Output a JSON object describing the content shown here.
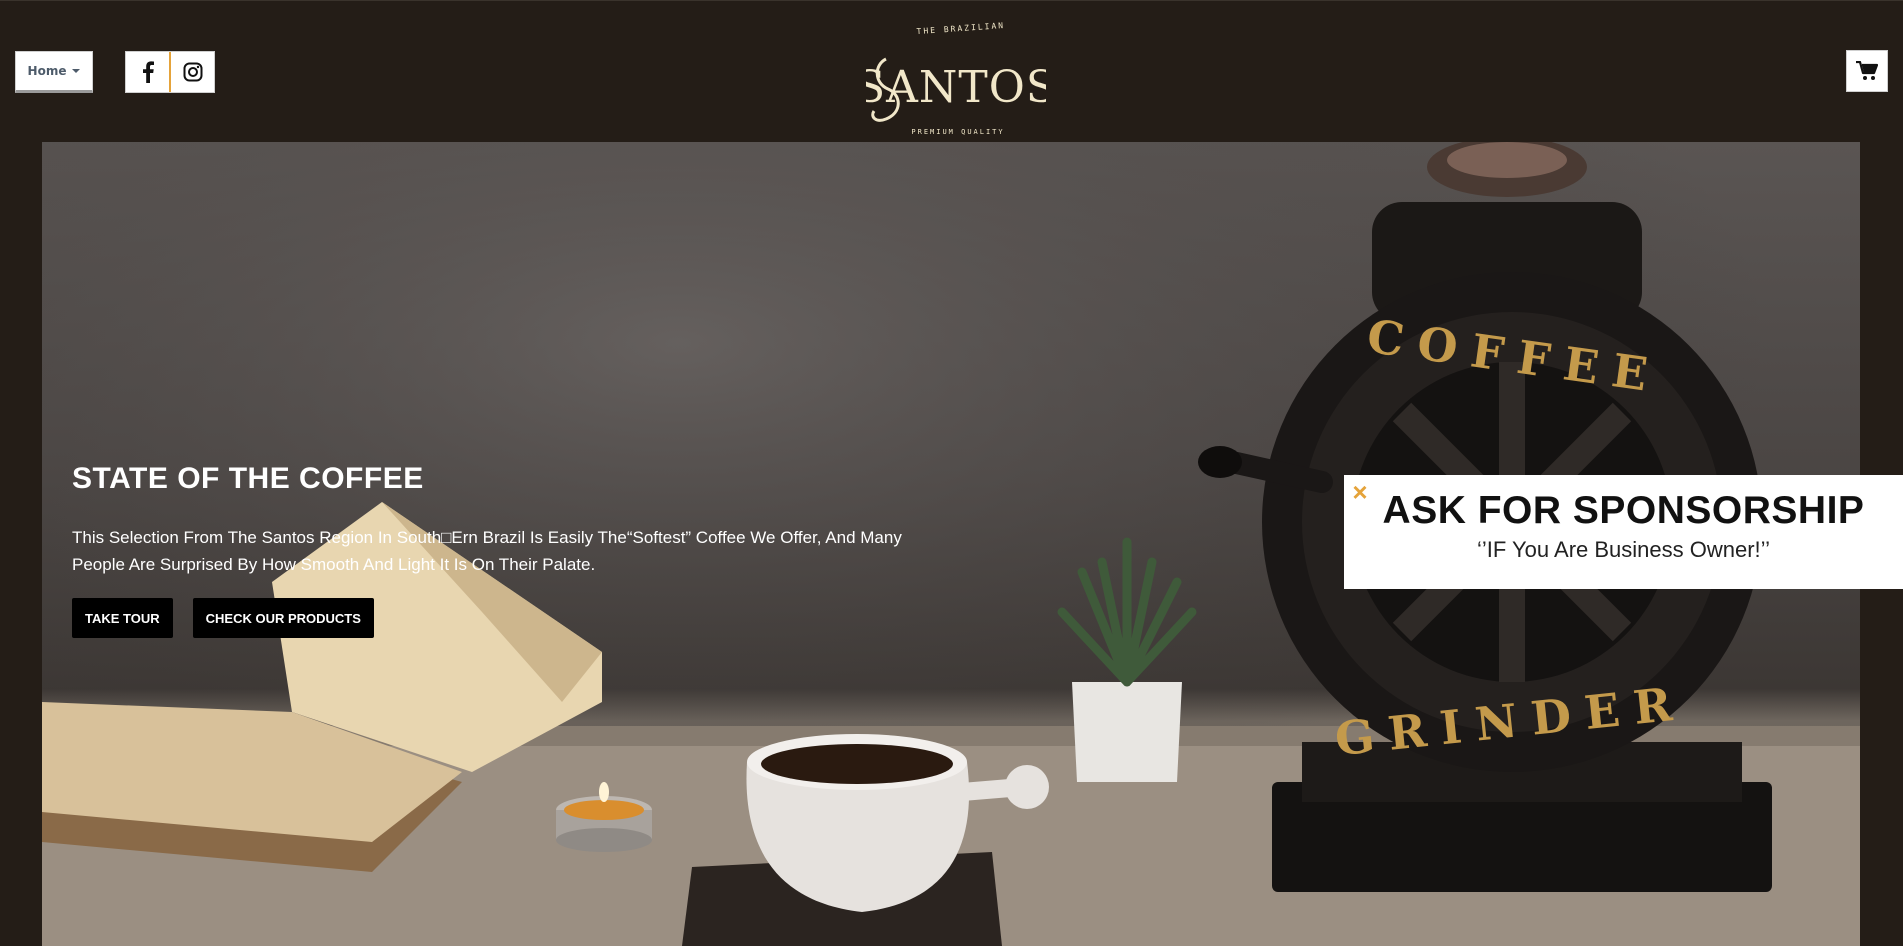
{
  "nav": {
    "menu_label": "Home",
    "icons": [
      "chevron-down-icon",
      "facebook-icon",
      "instagram-icon",
      "cart-icon"
    ]
  },
  "logo": {
    "top_text": "THE BRAZILIAN",
    "brand": "SANTOS",
    "bottom_text": "PREMIUM QUALITY"
  },
  "hero": {
    "title": "STATE OF THE COFFEE",
    "description": "This Selection From The Santos Region In South□Ern Brazil Is Easily The“Softest” Coffee We Offer, And Many People Are Surprised By How Smooth And Light It Is On Their Palate.",
    "buttons": {
      "tour": "TAKE TOUR",
      "products": "CHECK OUR PRODUCTS"
    },
    "grinder_text": {
      "top": "COFFEE",
      "bottom": "GRINDER"
    }
  },
  "sponsor": {
    "close_label": "×",
    "title": "ASK FOR SPONSORSHIP",
    "subtitle": "‘’IF You Are Business Owner!’’"
  },
  "colors": {
    "page_bg": "#241d17",
    "accent": "#e5a33a",
    "button_bg": "#000000",
    "logo_cream": "#f1e7c9"
  }
}
